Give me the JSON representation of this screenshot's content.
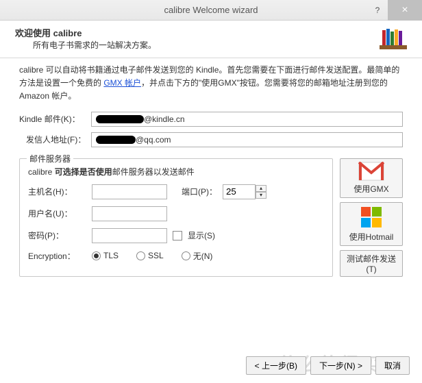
{
  "titlebar": {
    "title": "calibre Welcome wizard"
  },
  "header": {
    "title": "欢迎使用 calibre",
    "subtitle": "所有电子书需求的一站解决方案。"
  },
  "intro": {
    "l1a": "calibre 可以自动将书籍通过电子邮件发送到您的 Kindle。首先您需要在下面进行邮件发送配置。最简单的方法是设置一个免费的 ",
    "link": "GMX 帐户",
    "l1b": "，并点击下方的\"使用GMX\"按钮。您需要将您的邮箱地址注册到您的 Amazon 帐户。"
  },
  "fields": {
    "kindle_label": "Kindle 邮件(K)：",
    "kindle_suffix": "@kindle.cn",
    "from_label": "发信人地址(F)：",
    "from_suffix": "@qq.com"
  },
  "server": {
    "group_title": "邮件服务器",
    "desc_a": "calibre ",
    "desc_b": "可选择是否使用",
    "desc_c": "邮件服务器以发送邮件",
    "host_label": "主机名(H)：",
    "port_label": "端口(P)：",
    "port_value": "25",
    "user_label": "用户名(U)：",
    "pass_label": "密码(P)：",
    "show_label": "显示(S)",
    "enc_label": "Encryption：",
    "enc_tls": "TLS",
    "enc_ssl": "SSL",
    "enc_none": "无(N)"
  },
  "side": {
    "gmx": "使用GMX",
    "hotmail": "使用Hotmail",
    "test": "测试邮件发送(T)"
  },
  "nav": {
    "back": "< 上一步(B)",
    "next": "下一步(N) >",
    "cancel": "取消"
  }
}
